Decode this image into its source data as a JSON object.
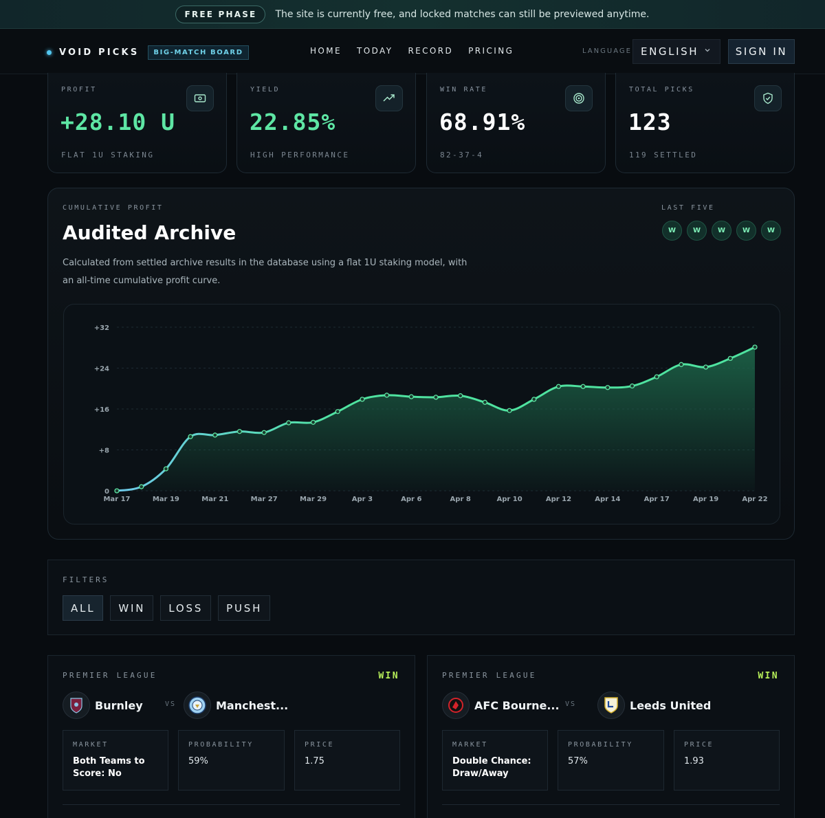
{
  "banner": {
    "pill": "FREE PHASE",
    "message": "The site is currently free, and locked matches can still be previewed anytime."
  },
  "nav": {
    "brand": "VOID PICKS",
    "brand_tag": "BIG-MATCH BOARD",
    "links": [
      "HOME",
      "TODAY",
      "RECORD",
      "PRICING"
    ],
    "language_label": "LANGUAGE",
    "language_value": "ENGLISH",
    "signin": "SIGN IN"
  },
  "stats": [
    {
      "label": "PROFIT",
      "value": "+28.10 U",
      "sub": "FLAT 1U STAKING",
      "icon": "cash-icon",
      "color": "#5ee6a4"
    },
    {
      "label": "YIELD",
      "value": "22.85%",
      "sub": "HIGH PERFORMANCE",
      "icon": "trending-up-icon",
      "color": "#5ee6a4"
    },
    {
      "label": "WIN RATE",
      "value": "68.91%",
      "sub": "82-37-4",
      "icon": "target-icon",
      "color": "#ffffff"
    },
    {
      "label": "TOTAL PICKS",
      "value": "123",
      "sub": "119 SETTLED",
      "icon": "shield-check-icon",
      "color": "#ffffff"
    }
  ],
  "archive": {
    "kicker": "CUMULATIVE PROFIT",
    "title": "Audited Archive",
    "description": "Calculated from settled archive results in the database using a flat 1U staking model, with an all-time cumulative profit curve.",
    "last_five_label": "LAST FIVE",
    "last_five": [
      "W",
      "W",
      "W",
      "W",
      "W"
    ]
  },
  "chart_data": {
    "type": "area",
    "y_ticks": [
      "0",
      "+8",
      "+16",
      "+24",
      "+32"
    ],
    "ylim": [
      0,
      32
    ],
    "x_tick_labels": [
      "Mar 17",
      "Mar 19",
      "Mar 21",
      "Mar 27",
      "Mar 29",
      "Apr 3",
      "Apr 6",
      "Apr 8",
      "Apr 10",
      "Apr 12",
      "Apr 14",
      "Apr 17",
      "Apr 19",
      "Apr 22"
    ],
    "values": [
      0,
      0.8,
      4.3,
      10.6,
      10.9,
      11.6,
      11.4,
      13.3,
      13.4,
      15.5,
      17.9,
      18.7,
      18.4,
      18.3,
      18.6,
      17.3,
      15.7,
      17.9,
      20.4,
      20.4,
      20.2,
      20.5,
      22.3,
      24.7,
      24.2,
      25.9,
      28.1
    ],
    "colors": {
      "line_start": "#6ec9ea",
      "line_end": "#4fe3a0",
      "fill": "#1e6a4c"
    }
  },
  "filters": {
    "label": "FILTERS",
    "options": [
      "ALL",
      "WIN",
      "LOSS",
      "PUSH"
    ],
    "active": "ALL"
  },
  "matches": [
    {
      "league": "PREMIER LEAGUE",
      "result": "WIN",
      "home": "Burnley",
      "away": "Manchest...",
      "vs": "VS",
      "home_icon": "burnley-crest-icon",
      "away_icon": "man-city-crest-icon",
      "market_label": "MARKET",
      "market": "Both Teams to Score: No",
      "prob_label": "PROBABILITY",
      "prob": "59%",
      "price_label": "PRICE",
      "price": "1.75"
    },
    {
      "league": "PREMIER LEAGUE",
      "result": "WIN",
      "home": "AFC Bourne...",
      "away": "Leeds United",
      "vs": "VS",
      "home_icon": "bournemouth-crest-icon",
      "away_icon": "leeds-crest-icon",
      "market_label": "MARKET",
      "market": "Double Chance: Draw/Away",
      "prob_label": "PROBABILITY",
      "prob": "57%",
      "price_label": "PRICE",
      "price": "1.93"
    }
  ]
}
